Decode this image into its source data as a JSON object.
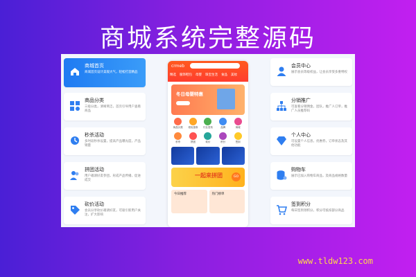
{
  "title": "商城系统完整源码",
  "left_cards": [
    {
      "title": "商城首页",
      "desc": "商城首页设计美观大气，轻松打造精品"
    },
    {
      "title": "商品分类",
      "desc": "三级分类，清晰简洁，首页引导用户查看商品"
    },
    {
      "title": "秒杀活动",
      "desc": "多时段秒杀设置，提高产品曝光度，产品销量"
    },
    {
      "title": "拼团活动",
      "desc": "用户邀请好友参团，形成产品传播，促进成交"
    },
    {
      "title": "砍价活动",
      "desc": "会员分享砍价邀请好友，可吸引新用户关注，扩大影响"
    }
  ],
  "right_cards": [
    {
      "title": "会员中心",
      "desc": "展示会员等级权益，让会员享受多重特权"
    },
    {
      "title": "分销推广",
      "desc": "可查看分销佣金，团队，推广人订单，推广人员推荐码"
    },
    {
      "title": "个人中心",
      "desc": "可设置个人信息，优惠券，订单状态及其他功能"
    },
    {
      "title": "购物车",
      "desc": "展示已加入购物车商品，及商品规格数量"
    },
    {
      "title": "签到积分",
      "desc": "每日签到领积分，积分可抵扣部分商品"
    }
  ],
  "phone": {
    "logo": "crmeb",
    "tabs": [
      "精选",
      "服饰鞋包",
      "母婴",
      "珠宝生活",
      "食品",
      "美妆"
    ],
    "banner_title": "冬日母婴特惠",
    "grid_labels": [
      "商品分类",
      "领优惠券",
      "行业发布",
      "品牌",
      "商城",
      "秒杀",
      "拼团",
      "砍价",
      "积分",
      "签到"
    ],
    "pintuan_text": "一起来拼团",
    "go_label": "GO",
    "bottom_labels": [
      "今日推荐",
      "热门榜单"
    ]
  },
  "watermark": "www.tldw123.com",
  "colors": {
    "accent_blue": "#1f7bf2",
    "brand_orange": "#ff5a1f"
  },
  "icons": [
    "home-icon",
    "grid-icon",
    "clock-icon",
    "users-icon",
    "tag-icon",
    "user-icon",
    "share-icon",
    "diamond-icon",
    "database-icon",
    "cart-icon"
  ]
}
